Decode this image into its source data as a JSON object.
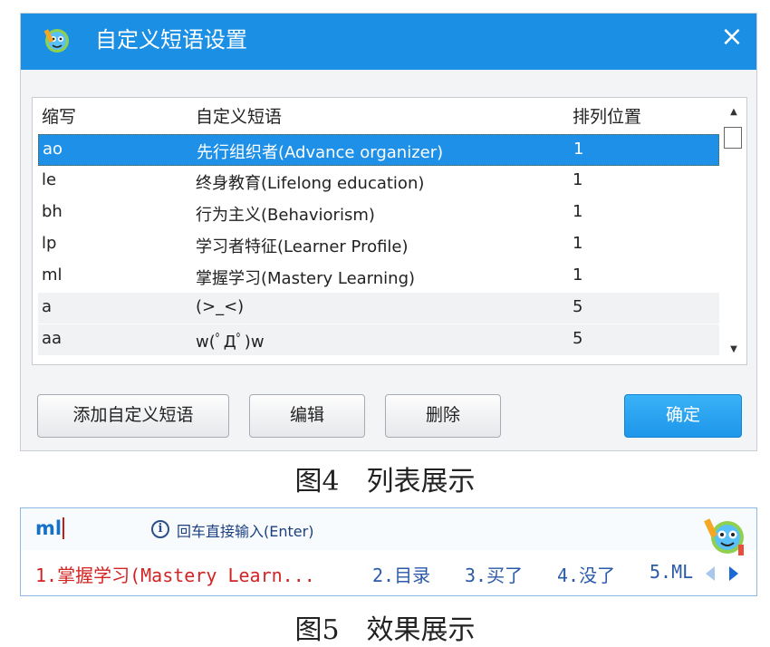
{
  "dialog": {
    "title": "自定义短语设置",
    "close_label": "×",
    "columns": [
      "缩写",
      "自定义短语",
      "排列位置"
    ],
    "rows": [
      {
        "abbr": "ao",
        "phrase": "先行组织者(Advance organizer)",
        "pos": "1"
      },
      {
        "abbr": "le",
        "phrase": "终身教育(Lifelong education)",
        "pos": "1"
      },
      {
        "abbr": "bh",
        "phrase": "行为主义(Behaviorism)",
        "pos": "1"
      },
      {
        "abbr": "lp",
        "phrase": "学习者特征(Learner Profile)",
        "pos": "1"
      },
      {
        "abbr": "ml",
        "phrase": "掌握学习(Mastery Learning)",
        "pos": "1"
      },
      {
        "abbr": "a",
        "phrase": "(>_<)",
        "pos": "5"
      },
      {
        "abbr": "aa",
        "phrase": "w(ﾟДﾟ)w",
        "pos": "5"
      }
    ],
    "buttons": {
      "add": "添加自定义短语",
      "edit": "编辑",
      "delete": "删除",
      "ok": "确定"
    }
  },
  "captions": {
    "fig4": "图4　列表展示",
    "fig5": "图5　效果展示"
  },
  "ime": {
    "typed": "ml",
    "hint": "回车直接输入(Enter)",
    "candidates": [
      "1.掌握学习(Mastery Learn...",
      "2.目录",
      "3.买了",
      "4.没了",
      "5.ML"
    ]
  },
  "colors": {
    "accent": "#1b8fe3",
    "selected_row": "#1e90e8",
    "ok_button": "#2aa2f0",
    "first_candidate": "#d22424"
  },
  "icons": [
    "app-mascot-icon",
    "close-icon",
    "scroll-up-icon",
    "scroll-down-icon",
    "info-icon",
    "mascot-icon",
    "prev-page-icon",
    "next-page-icon"
  ]
}
